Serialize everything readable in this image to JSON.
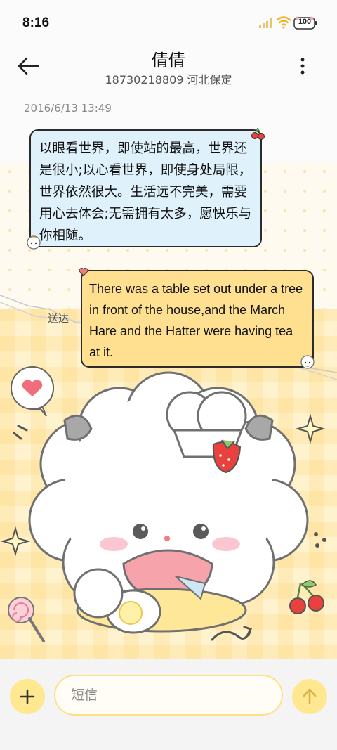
{
  "status_bar": {
    "time": "8:16",
    "battery_level": "100",
    "icons": [
      "signal-icon",
      "wifi-icon",
      "battery-icon"
    ]
  },
  "header": {
    "contact_name": "倩倩",
    "contact_info": "18730218809 河北保定",
    "icons": [
      "back-arrow-icon",
      "more-vertical-icon"
    ]
  },
  "conversation": {
    "timestamp": "2016/6/13 13:49",
    "messages": [
      {
        "direction": "incoming",
        "text": "以眼看世界，即使站的最高，世界还是很小;以心看世界，即使身处局限，世界依然很大。生活远不完美，需要用心去体会;无需拥有太多，愿快乐与你相随。"
      },
      {
        "direction": "outgoing",
        "text": "There was a table set out under a tree in front of the house,and the March Hare and the Hatter were having tea at it.",
        "status": "送达"
      }
    ]
  },
  "composer": {
    "placeholder": "短信",
    "icons": [
      "plus-icon",
      "send-arrow-icon"
    ]
  },
  "theme_colors": {
    "incoming_bubble": "#dff1fb",
    "outgoing_bubble": "#ffe090",
    "accent": "#ffe88f",
    "bubble_border": "#2b2b2b"
  }
}
